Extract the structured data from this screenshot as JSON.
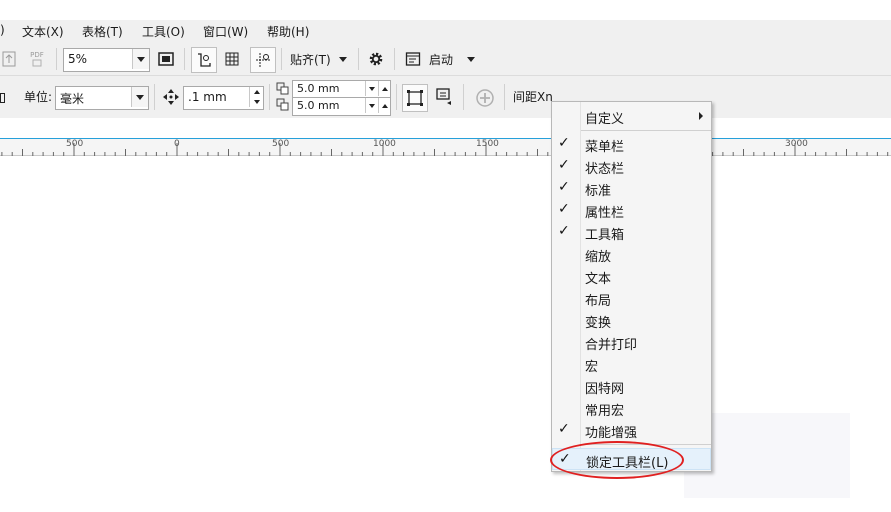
{
  "menubar": {
    "items": [
      {
        "label": ")"
      },
      {
        "label": "文本(X)"
      },
      {
        "label": "表格(T)"
      },
      {
        "label": "工具(O)"
      },
      {
        "label": "窗口(W)"
      },
      {
        "label": "帮助(H)"
      }
    ]
  },
  "toolbar1": {
    "pdf_label": "PDF",
    "zoom_value": "5%",
    "snap_label": "贴齐(T)",
    "launch_label": "启动"
  },
  "toolbar2": {
    "unit_label": "单位:",
    "unit_value": "毫米",
    "nudge_value": ".1 mm",
    "dup_x_value": "5.0 mm",
    "dup_y_value": "5.0 mm",
    "spacing_label": "间距Xn"
  },
  "ruler": {
    "labels": [
      "500",
      "0",
      "500",
      "1000",
      "1500",
      "3000"
    ]
  },
  "context_menu": {
    "customize_label": "自定义",
    "items": [
      {
        "label": "菜单栏",
        "checked": true
      },
      {
        "label": "状态栏",
        "checked": true
      },
      {
        "label": "标准",
        "checked": true
      },
      {
        "label": "属性栏",
        "checked": true
      },
      {
        "label": "工具箱",
        "checked": true
      },
      {
        "label": "缩放",
        "checked": false
      },
      {
        "label": "文本",
        "checked": false
      },
      {
        "label": "布局",
        "checked": false
      },
      {
        "label": "变换",
        "checked": false
      },
      {
        "label": "合并打印",
        "checked": false
      },
      {
        "label": "宏",
        "checked": false
      },
      {
        "label": "因特网",
        "checked": false
      },
      {
        "label": "常用宏",
        "checked": false
      },
      {
        "label": "功能增强",
        "checked": true
      }
    ],
    "lock_label": "锁定工具栏(L)",
    "lock_checked": true,
    "check_glyph": "✓"
  },
  "colors": {
    "accent_line": "#26a0da",
    "annotation_red": "#e02020"
  }
}
